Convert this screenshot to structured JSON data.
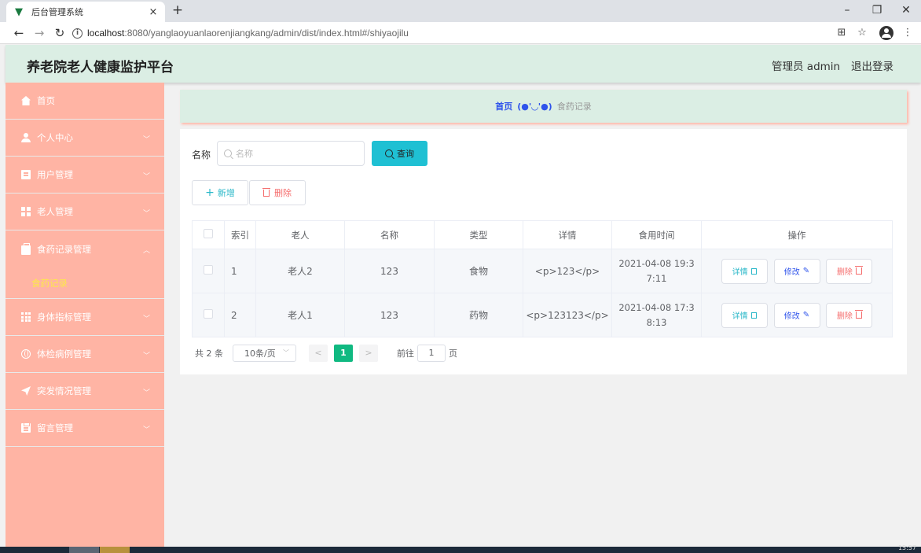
{
  "browser": {
    "tab_title": "后台管理系统",
    "close_glyph": "×",
    "newtab_glyph": "+",
    "url_host": "localhost",
    "url_rest": ":8080/yanglaoyuanlaorenjiangkang/admin/dist/index.html#/shiyaojilu"
  },
  "header": {
    "title": "养老院老人健康监护平台",
    "user_label": "管理员 admin",
    "logout": "退出登录"
  },
  "sidebar": {
    "items": [
      {
        "label": "首页",
        "icon": "home-icon"
      },
      {
        "label": "个人中心",
        "icon": "user-icon"
      },
      {
        "label": "用户管理",
        "icon": "document-icon"
      },
      {
        "label": "老人管理",
        "icon": "grid-icon"
      },
      {
        "label": "食药记录管理",
        "icon": "briefcase-icon",
        "expanded": true,
        "children": [
          {
            "label": "食药记录"
          }
        ]
      },
      {
        "label": "身体指标管理",
        "icon": "apps-icon"
      },
      {
        "label": "体检病例管理",
        "icon": "globe-icon"
      },
      {
        "label": "突发情况管理",
        "icon": "send-icon"
      },
      {
        "label": "留言管理",
        "icon": "clipboard-icon"
      }
    ]
  },
  "breadcrumb": {
    "home": "首页",
    "separator": "(●'◡'●)",
    "current": "食药记录"
  },
  "search": {
    "label": "名称",
    "placeholder": "名称",
    "value": "",
    "button": "查询"
  },
  "actions": {
    "add": "新增",
    "delete": "删除"
  },
  "table": {
    "columns": [
      "索引",
      "老人",
      "名称",
      "类型",
      "详情",
      "食用时间",
      "操作"
    ],
    "rows": [
      {
        "index": "1",
        "elder": "老人2",
        "name": "123",
        "type": "食物",
        "detail": "<p>123</p>",
        "time_line1": "2021-04-08 19:3",
        "time_line2": "7:11"
      },
      {
        "index": "2",
        "elder": "老人1",
        "name": "123",
        "type": "药物",
        "detail": "<p>123123</p>",
        "time_line1": "2021-04-08 17:3",
        "time_line2": "8:13"
      }
    ],
    "op_detail": "详情",
    "op_edit": "修改",
    "op_delete": "删除"
  },
  "pagination": {
    "total": "共 2 条",
    "page_size": "10条/页",
    "prev": "<",
    "current": "1",
    "next": ">",
    "goto_prefix": "前往",
    "goto_value": "1",
    "goto_suffix": "页"
  },
  "taskbar": {
    "clock": "15:57"
  },
  "colors": {
    "sidebar_bg": "#ffb4a4",
    "header_bg": "#dbeee4",
    "query_button": "#1fc0d3",
    "active_page": "#10b981",
    "submenu_active": "#fde74c"
  }
}
